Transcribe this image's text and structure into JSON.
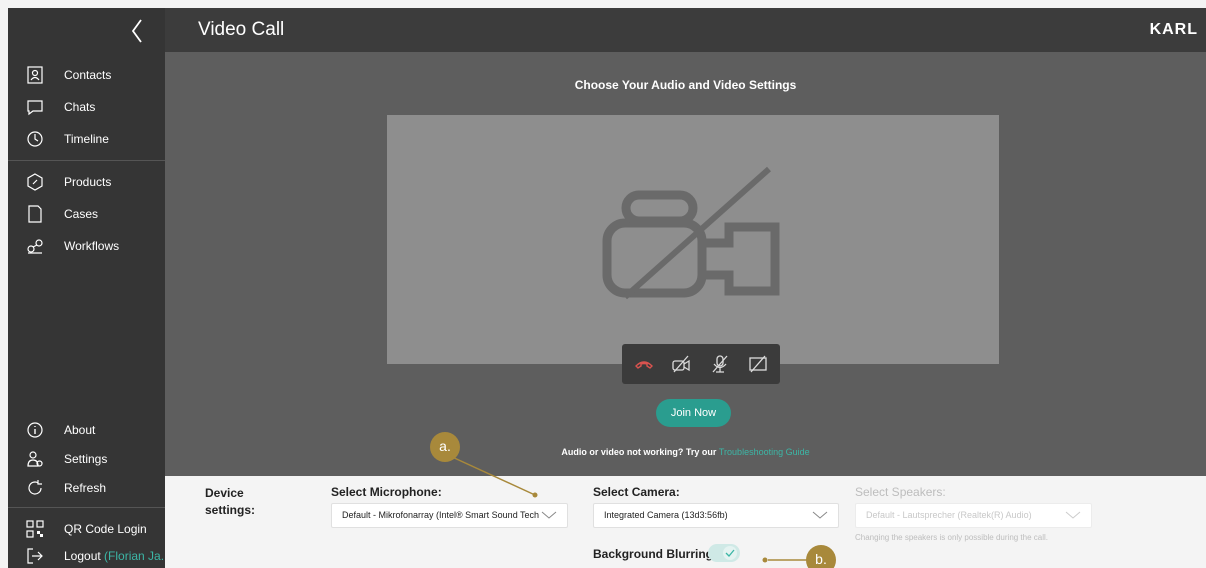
{
  "sidebar": {
    "items": [
      {
        "label": "Contacts",
        "icon": "contacts-icon"
      },
      {
        "label": "Chats",
        "icon": "chat-icon"
      },
      {
        "label": "Timeline",
        "icon": "timeline-icon"
      },
      {
        "label": "Products",
        "icon": "products-icon"
      },
      {
        "label": "Cases",
        "icon": "cases-icon"
      },
      {
        "label": "Workflows",
        "icon": "workflows-icon"
      }
    ],
    "bottom_items": [
      {
        "label": "About",
        "icon": "info-icon"
      },
      {
        "label": "Settings",
        "icon": "settings-icon"
      },
      {
        "label": "Refresh",
        "icon": "refresh-icon"
      },
      {
        "label": "QR Code Login",
        "icon": "qr-code-icon"
      },
      {
        "label": "Logout",
        "icon": "logout-icon"
      }
    ],
    "user": "(Florian Ja..."
  },
  "header": {
    "title": "Video Call",
    "brand": "KARL"
  },
  "main": {
    "heading": "Choose Your Audio and Video Settings",
    "join_label": "Join Now",
    "trouble_text": "Audio or video not working? Try our",
    "trouble_link": "Troubleshooting Guide"
  },
  "device_settings": {
    "label": "Device settings:",
    "microphone": {
      "label": "Select Microphone:",
      "value": "Default - Mikrofonarray (Intel® Smart Sound Tech"
    },
    "camera": {
      "label": "Select Camera:",
      "value": "Integrated Camera (13d3:56fb)"
    },
    "speakers": {
      "label": "Select Speakers:",
      "value": "Default - Lautsprecher (Realtek(R) Audio)",
      "hint": "Changing the speakers is only possible during the call."
    },
    "blur": {
      "label": "Background Blurring:",
      "enabled": true
    }
  },
  "annotations": {
    "a": "a.",
    "b": "b."
  },
  "colors": {
    "accent": "#2a9d8f",
    "link": "#3cb6a6",
    "annotation": "#a8893b",
    "hangup": "#d9534f"
  }
}
